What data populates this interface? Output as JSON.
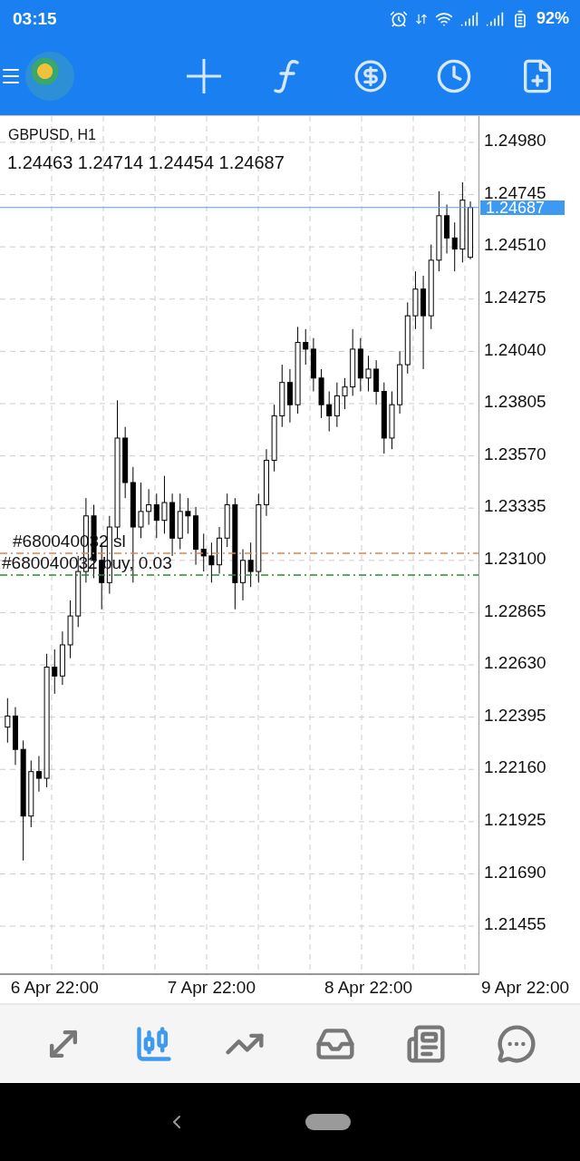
{
  "status_bar": {
    "time": "03:15",
    "battery": "92%"
  },
  "chart": {
    "symbol": "GBPUSD, H1",
    "ohlc": "1.24463 1.24714 1.24454 1.24687",
    "current_price": "1.24687",
    "chart_data": {
      "type": "candlestick",
      "grid": true,
      "ylim": [
        1.21235,
        1.25098
      ],
      "categories": [
        null,
        null,
        null,
        null,
        null,
        null,
        "6 Apr 22:00",
        null,
        null,
        null,
        null,
        null,
        null,
        null,
        null,
        null,
        null,
        null,
        null,
        null,
        null,
        null,
        null,
        null,
        null,
        null,
        "7 Apr 22:00",
        null,
        null,
        null,
        null,
        null,
        null,
        null,
        null,
        null,
        null,
        null,
        null,
        null,
        null,
        null,
        null,
        null,
        null,
        null,
        "8 Apr 22:00",
        null,
        null,
        null,
        null,
        null,
        null,
        null,
        null,
        null,
        null,
        null,
        null,
        null,
        null,
        null,
        null,
        null,
        null,
        null,
        "9 Apr 22:00"
      ],
      "ref_lines": [
        {
          "axis": "y",
          "value": 1.24687,
          "color": "#5b9ee0"
        },
        {
          "axis": "y",
          "value": 1.23132,
          "color": "#e8804a"
        },
        {
          "axis": "y",
          "value": 1.23034,
          "color": "#2e8b3e"
        }
      ],
      "ohlc": [
        [
          1.2235,
          1.2248,
          1.2228,
          1.224
        ],
        [
          1.224,
          1.2244,
          1.2218,
          1.2225
        ],
        [
          1.2225,
          1.2229,
          1.2175,
          1.2195
        ],
        [
          1.2195,
          1.222,
          1.219,
          1.2215
        ],
        [
          1.2215,
          1.2222,
          1.2206,
          1.2212
        ],
        [
          1.2212,
          1.2268,
          1.2208,
          1.2262
        ],
        [
          1.2262,
          1.227,
          1.225,
          1.2258
        ],
        [
          1.2258,
          1.2278,
          1.2254,
          1.2272
        ],
        [
          1.2272,
          1.2292,
          1.2266,
          1.2285
        ],
        [
          1.2285,
          1.2312,
          1.228,
          1.2305
        ],
        [
          1.2305,
          1.2338,
          1.23,
          1.233
        ],
        [
          1.233,
          1.2335,
          1.2302,
          1.231
        ],
        [
          1.231,
          1.2318,
          1.2288,
          1.23
        ],
        [
          1.23,
          1.233,
          1.2295,
          1.2325
        ],
        [
          1.2325,
          1.2382,
          1.232,
          1.2365
        ],
        [
          1.2365,
          1.237,
          1.2338,
          1.2345
        ],
        [
          1.2345,
          1.2352,
          1.23,
          1.2325
        ],
        [
          1.2325,
          1.2345,
          1.232,
          1.2332
        ],
        [
          1.2332,
          1.2342,
          1.2326,
          1.2335
        ],
        [
          1.2335,
          1.234,
          1.232,
          1.2328
        ],
        [
          1.2328,
          1.2348,
          1.2322,
          1.2336
        ],
        [
          1.2336,
          1.234,
          1.2312,
          1.232
        ],
        [
          1.232,
          1.234,
          1.2315,
          1.2332
        ],
        [
          1.2332,
          1.2338,
          1.2322,
          1.233
        ],
        [
          1.233,
          1.2334,
          1.2308,
          1.2315
        ],
        [
          1.2315,
          1.2322,
          1.2305,
          1.2312
        ],
        [
          1.2312,
          1.2318,
          1.23,
          1.2308
        ],
        [
          1.2308,
          1.2325,
          1.2304,
          1.232
        ],
        [
          1.232,
          1.234,
          1.2316,
          1.2335
        ],
        [
          1.2335,
          1.2338,
          1.2288,
          1.23
        ],
        [
          1.23,
          1.2315,
          1.2292,
          1.231
        ],
        [
          1.231,
          1.2318,
          1.2298,
          1.2305
        ],
        [
          1.2305,
          1.234,
          1.23,
          1.2335
        ],
        [
          1.2335,
          1.236,
          1.233,
          1.2355
        ],
        [
          1.2355,
          1.238,
          1.235,
          1.2375
        ],
        [
          1.2375,
          1.2398,
          1.237,
          1.239
        ],
        [
          1.239,
          1.2396,
          1.2372,
          1.238
        ],
        [
          1.238,
          1.2415,
          1.2376,
          1.2408
        ],
        [
          1.2408,
          1.2414,
          1.2398,
          1.2405
        ],
        [
          1.2405,
          1.241,
          1.2386,
          1.2392
        ],
        [
          1.2392,
          1.2396,
          1.2374,
          1.238
        ],
        [
          1.238,
          1.2386,
          1.2368,
          1.2375
        ],
        [
          1.2375,
          1.239,
          1.237,
          1.2384
        ],
        [
          1.2384,
          1.2392,
          1.2378,
          1.2388
        ],
        [
          1.2388,
          1.2414,
          1.2384,
          1.2405
        ],
        [
          1.2405,
          1.241,
          1.2386,
          1.2392
        ],
        [
          1.2392,
          1.2402,
          1.2386,
          1.2396
        ],
        [
          1.2396,
          1.24,
          1.238,
          1.2386
        ],
        [
          1.2386,
          1.239,
          1.2358,
          1.2365
        ],
        [
          1.2365,
          1.2386,
          1.236,
          1.238
        ],
        [
          1.238,
          1.2404,
          1.2376,
          1.2398
        ],
        [
          1.2398,
          1.2426,
          1.2394,
          1.242
        ],
        [
          1.242,
          1.244,
          1.2414,
          1.2432
        ],
        [
          1.2432,
          1.2438,
          1.2396,
          1.242
        ],
        [
          1.242,
          1.2452,
          1.2414,
          1.2445
        ],
        [
          1.2445,
          1.2476,
          1.244,
          1.2465
        ],
        [
          1.2465,
          1.247,
          1.2448,
          1.2455
        ],
        [
          1.2455,
          1.2462,
          1.244,
          1.245
        ],
        [
          1.245,
          1.248,
          1.2444,
          1.2472
        ],
        [
          1.24463,
          1.24714,
          1.24454,
          1.24687
        ],
        null,
        null,
        null,
        null,
        null,
        null,
        null
      ],
      "yticks": [
        {
          "value": 1.2498,
          "label": "1.24980"
        },
        {
          "value": 1.24745,
          "label": "1.24745"
        },
        {
          "value": 1.2451,
          "label": "1.24510"
        },
        {
          "value": 1.24275,
          "label": "1.24275"
        },
        {
          "value": 1.2404,
          "label": "1.24040"
        },
        {
          "value": 1.23805,
          "label": "1.23805"
        },
        {
          "value": 1.2357,
          "label": "1.23570"
        },
        {
          "value": 1.23335,
          "label": "1.23335"
        },
        {
          "value": 1.231,
          "label": "1.23100"
        },
        {
          "value": 1.22865,
          "label": "1.22865"
        },
        {
          "value": 1.2263,
          "label": "1.22630"
        },
        {
          "value": 1.22395,
          "label": "1.22395"
        },
        {
          "value": 1.2216,
          "label": "1.22160"
        },
        {
          "value": 1.21925,
          "label": "1.21925"
        },
        {
          "value": 1.2169,
          "label": "1.21690"
        },
        {
          "value": 1.21455,
          "label": "1.21455"
        }
      ]
    },
    "orders": [
      {
        "kind": "stop_loss",
        "label": "#680040032 sl"
      },
      {
        "kind": "position",
        "label": "#680040032 buy, 0.03"
      }
    ]
  },
  "bottom_nav": [
    {
      "kind": "trade",
      "selected": false
    },
    {
      "kind": "chart",
      "selected": true
    },
    {
      "kind": "history",
      "selected": false
    },
    {
      "kind": "inbox",
      "selected": false
    },
    {
      "kind": "news",
      "selected": false
    },
    {
      "kind": "chat",
      "selected": false
    }
  ]
}
